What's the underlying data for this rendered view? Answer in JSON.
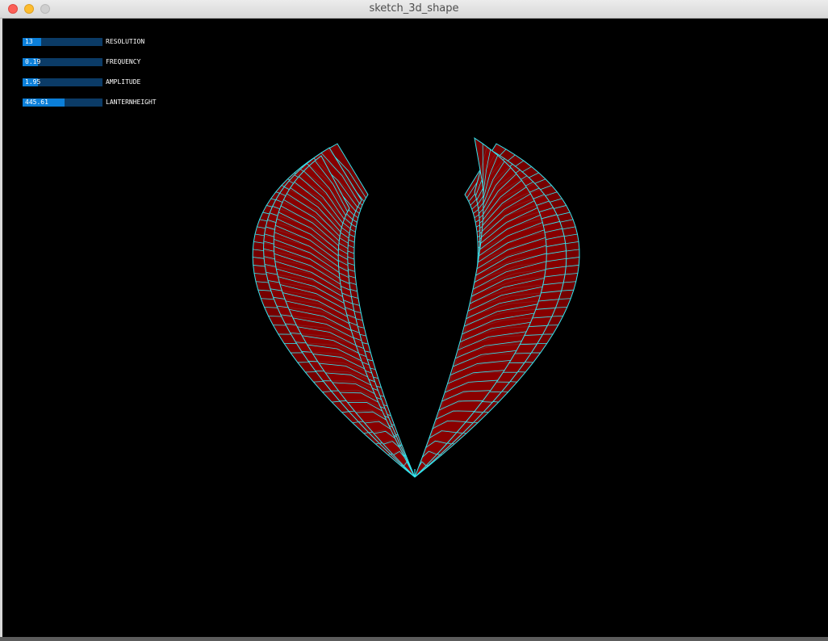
{
  "window": {
    "title": "sketch_3d_shape"
  },
  "controls": [
    {
      "label": "RESOLUTION",
      "value": "13",
      "fill_fraction": 0.23
    },
    {
      "label": "FREQUENCY",
      "value": "0.19",
      "fill_fraction": 0.19
    },
    {
      "label": "AMPLITUDE",
      "value": "1.95",
      "fill_fraction": 0.19
    },
    {
      "label": "LANTERNHEIGHT",
      "value": "445.61",
      "fill_fraction": 0.53
    }
  ],
  "colors": {
    "background": "#000000",
    "slider_track": "#0b3b66",
    "slider_fill": "#0b7fd9",
    "surface_fill": "#8b0000",
    "wireframe": "#33e6f0"
  },
  "scene": {
    "shape": "heart-like lantern surface, two wings meeting at a bottom tip",
    "style": "red filled quads with cyan wireframe edges"
  }
}
